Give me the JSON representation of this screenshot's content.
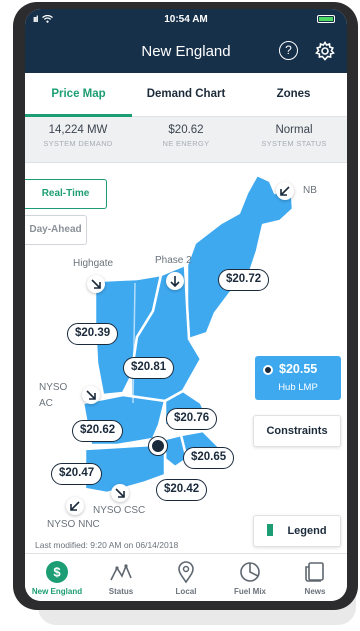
{
  "status_bar": {
    "signal": "ııl",
    "wifi": "wifi-icon",
    "time": "10:54 AM"
  },
  "header": {
    "title": "New England",
    "help_symbol": "?"
  },
  "tabs": [
    {
      "label": "Price Map",
      "active": true
    },
    {
      "label": "Demand Chart",
      "active": false
    },
    {
      "label": "Zones",
      "active": false
    }
  ],
  "stats": [
    {
      "value": "14,224 MW",
      "label": "SYSTEM DEMAND"
    },
    {
      "value": "$20.62",
      "label": "NE ENERGY"
    },
    {
      "value": "Normal",
      "label": "SYSTEM STATUS"
    }
  ],
  "map": {
    "modes": {
      "real_time": "Real-Time",
      "day_ahead": "Day-Ahead"
    },
    "region_labels": {
      "nb": "NB",
      "highgate": "Highgate",
      "phase2": "Phase 2",
      "nyso_ac": "NYSO\nAC",
      "nyso_csc": "NYSO CSC",
      "nyso_nnc": "NYSO NNC"
    },
    "prices": {
      "maine": "$20.72",
      "vermont": "$20.39",
      "new_hampshire": "$20.81",
      "wcma": "$20.62",
      "nema": "$20.76",
      "rhode_island": "$20.65",
      "connecticut": "$20.47",
      "semass": "$20.42"
    },
    "hub": {
      "price": "$20.55",
      "label": "Hub LMP"
    },
    "constraints_label": "Constraints",
    "legend_label": "Legend",
    "last_modified": "Last modified: 9:20 AM on 06/14/2018",
    "colors": {
      "region_fill": "#3fa9f0",
      "accent": "#1d9d73",
      "header": "#173049"
    }
  },
  "bottom_nav": [
    {
      "label": "New England",
      "icon": "dollar-icon",
      "active": true
    },
    {
      "label": "Status",
      "icon": "status-chart-icon",
      "active": false
    },
    {
      "label": "Local",
      "icon": "location-pin-icon",
      "active": false
    },
    {
      "label": "Fuel Mix",
      "icon": "pie-chart-icon",
      "active": false
    },
    {
      "label": "News",
      "icon": "news-icon",
      "active": false
    }
  ]
}
